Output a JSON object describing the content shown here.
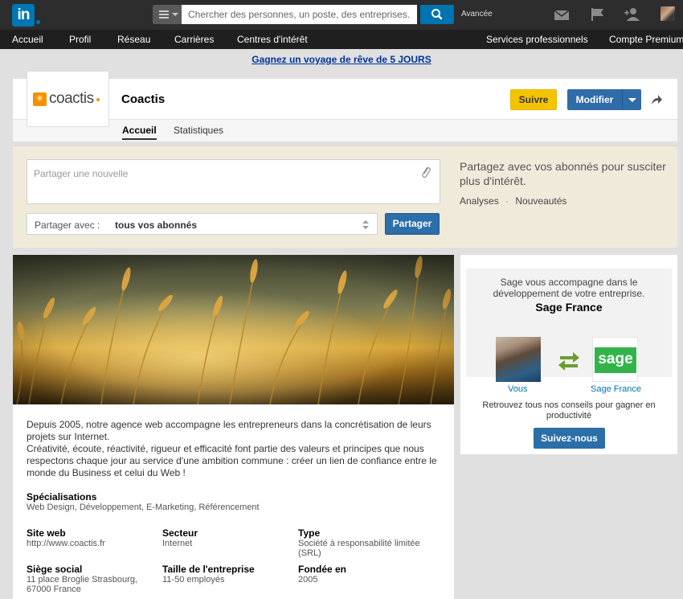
{
  "topbar": {
    "logo_text": "in",
    "search_placeholder": "Chercher des personnes, un poste, des entreprises...",
    "advanced_label": "Avancée",
    "icons": [
      "menu-icon",
      "search-icon",
      "mail-icon",
      "flag-icon",
      "add-connection-icon",
      "profile-avatar"
    ]
  },
  "nav": {
    "items": [
      "Accueil",
      "Profil",
      "Réseau",
      "Carrières",
      "Centres d'intérêt"
    ],
    "right_items": [
      "Services professionnels",
      "Compte Premium"
    ]
  },
  "promo": {
    "text": "Gagnez un voyage de rêve de 5 JOURS"
  },
  "company": {
    "logo_text": "coactis",
    "name": "Coactis",
    "tabs": [
      "Accueil",
      "Statistiques"
    ],
    "follow_label": "Suivre",
    "edit_label": "Modifier"
  },
  "share": {
    "placeholder": "Partager une nouvelle",
    "with_label": "Partager avec :",
    "with_value": "tous vos abonnés",
    "button_label": "Partager",
    "prompt": "Partagez avec vos abonnés pour susciter plus d'intérêt.",
    "link_analyses": "Analyses",
    "link_separator": "·",
    "link_news": "Nouveautés"
  },
  "about": {
    "description_1": "Depuis 2005, notre agence web accompagne les entrepreneurs dans la concrétisation de leurs projets sur Internet.",
    "description_2": "Créativité, écoute, réactivité, rigueur et efficacité font partie des valeurs et principes que nous respectons chaque jour au service d'une ambition commune : créer un lien de confiance entre le monde du Business et celui du Web !",
    "specialties_label": "Spécialisations",
    "specialties_value": "Web Design, Développement, E-Marketing, Référencement",
    "website_label": "Site web",
    "website_value": "http://www.coactis.fr",
    "sector_label": "Secteur",
    "sector_value": "Internet",
    "type_label": "Type",
    "type_value": "Société à responsabilité limitée (SRL)",
    "hq_label": "Siège social",
    "hq_value": "11 place Broglie Strasbourg, 67000 France",
    "size_label": "Taille de l'entreprise",
    "size_value": "11-50 employés",
    "founded_label": "Fondée en",
    "founded_value": "2005"
  },
  "ad": {
    "intro": "Sage vous accompagne dans le développement de votre entreprise.",
    "name": "Sage France",
    "logo_text": "sage",
    "you_label": "Vous",
    "sage_label": "Sage France",
    "tip": "Retrouvez tous nos conseils pour gagner en productivité",
    "button_label": "Suivez-nous"
  },
  "colors": {
    "linkedin_blue": "#0077b5",
    "follow_yellow": "#f5c400",
    "button_blue": "#2b6ea8",
    "sage_green": "#33b44a",
    "coactis_orange": "#f39200"
  }
}
